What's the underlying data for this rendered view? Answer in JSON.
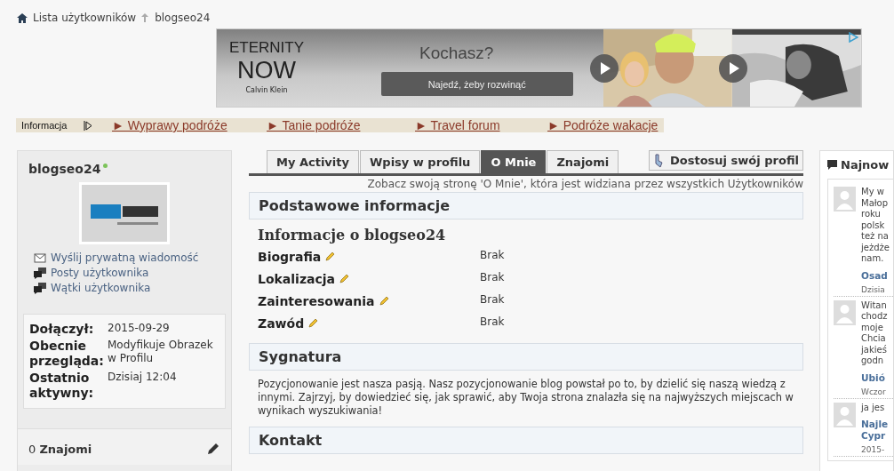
{
  "breadcrumb": [
    {
      "label": "Lista użytkowników",
      "kind": "home"
    },
    {
      "label": "blogseo24",
      "kind": "current"
    }
  ],
  "ad": {
    "logo_lines": [
      "ETERNITY",
      "NOW",
      "Calvin Klein"
    ],
    "headline": "Kochasz?",
    "button": "Najedź, żeby rozwinąć",
    "videos": [
      {
        "kind": "picture"
      },
      {
        "kind": "picture"
      }
    ]
  },
  "info_bar": {
    "label": "Informacja",
    "links": [
      "► Wyprawy podróże",
      "► Tanie podróże",
      "► Travel forum",
      "► Podróże wakacje"
    ]
  },
  "profile": {
    "username": "blogseo24",
    "online": true,
    "actions": [
      {
        "label": "Wyślij prywatną wiadomość",
        "kind": "message"
      },
      {
        "label": "Posty użytkownika",
        "kind": "posts"
      },
      {
        "label": "Wątki użytkownika",
        "kind": "threads"
      }
    ],
    "stats": [
      {
        "label": "Dołączył:",
        "value": "2015-09-29"
      },
      {
        "label": "Obecnie przegląda:",
        "value": "Modyfikuje Obrazek w Profilu"
      },
      {
        "label": "Ostatnio aktywny:",
        "value": "Dzisiaj 12:04"
      }
    ]
  },
  "friends": {
    "count": "0",
    "label": "Znajomi"
  },
  "tabs": [
    {
      "label": "My Activity",
      "selected": false
    },
    {
      "label": "Wpisy w profilu",
      "selected": false
    },
    {
      "label": "O Mnie",
      "selected": true
    },
    {
      "label": "Znajomi",
      "selected": false
    }
  ],
  "customize_button": "Dostosuj swój profil",
  "note": "Zobacz swoją stronę 'O Mnie', która jest widziana przez wszystkich Użytkowników",
  "sections": [
    {
      "title": "Podstawowe informacje",
      "kind": "fields",
      "subtitle": "Informacje o blogseo24",
      "fields": [
        {
          "label": "Biografia",
          "value": "Brak"
        },
        {
          "label": "Lokalizacja",
          "value": "Brak"
        },
        {
          "label": "Zainteresowania",
          "value": "Brak"
        },
        {
          "label": "Zawód",
          "value": "Brak"
        }
      ]
    },
    {
      "title": "Sygnatura",
      "kind": "text",
      "text": "Pozycjonowanie jest nasza pasją. Nasz pozycjonowanie blog powstał po to, by dzielić się naszą wiedzą z innymi. Zajrzyj, by dowiedzieć się, jak sprawić, aby Twoja strona znalazła się na najwyższych miejscach w wynikach wyszukiwania!"
    },
    {
      "title": "Kontakt",
      "kind": "empty"
    }
  ],
  "sidebar": {
    "title": "Najnow",
    "posts": [
      {
        "lines": [
          "My w",
          "Małop",
          "roku",
          "polsk",
          "też na",
          "jeżdże",
          "nam."
        ],
        "title_lines": [
          "Osad"
        ],
        "date": "Dzisia"
      },
      {
        "lines": [
          "Witan",
          "chodz",
          "moje",
          "Chcia",
          "jakieś",
          "godn"
        ],
        "title_lines": [
          "Ubió"
        ],
        "date": "Wczor"
      },
      {
        "lines": [
          "ja jes"
        ],
        "title_lines": [
          "Najle",
          "Cypr"
        ],
        "date": "2015-"
      }
    ]
  }
}
